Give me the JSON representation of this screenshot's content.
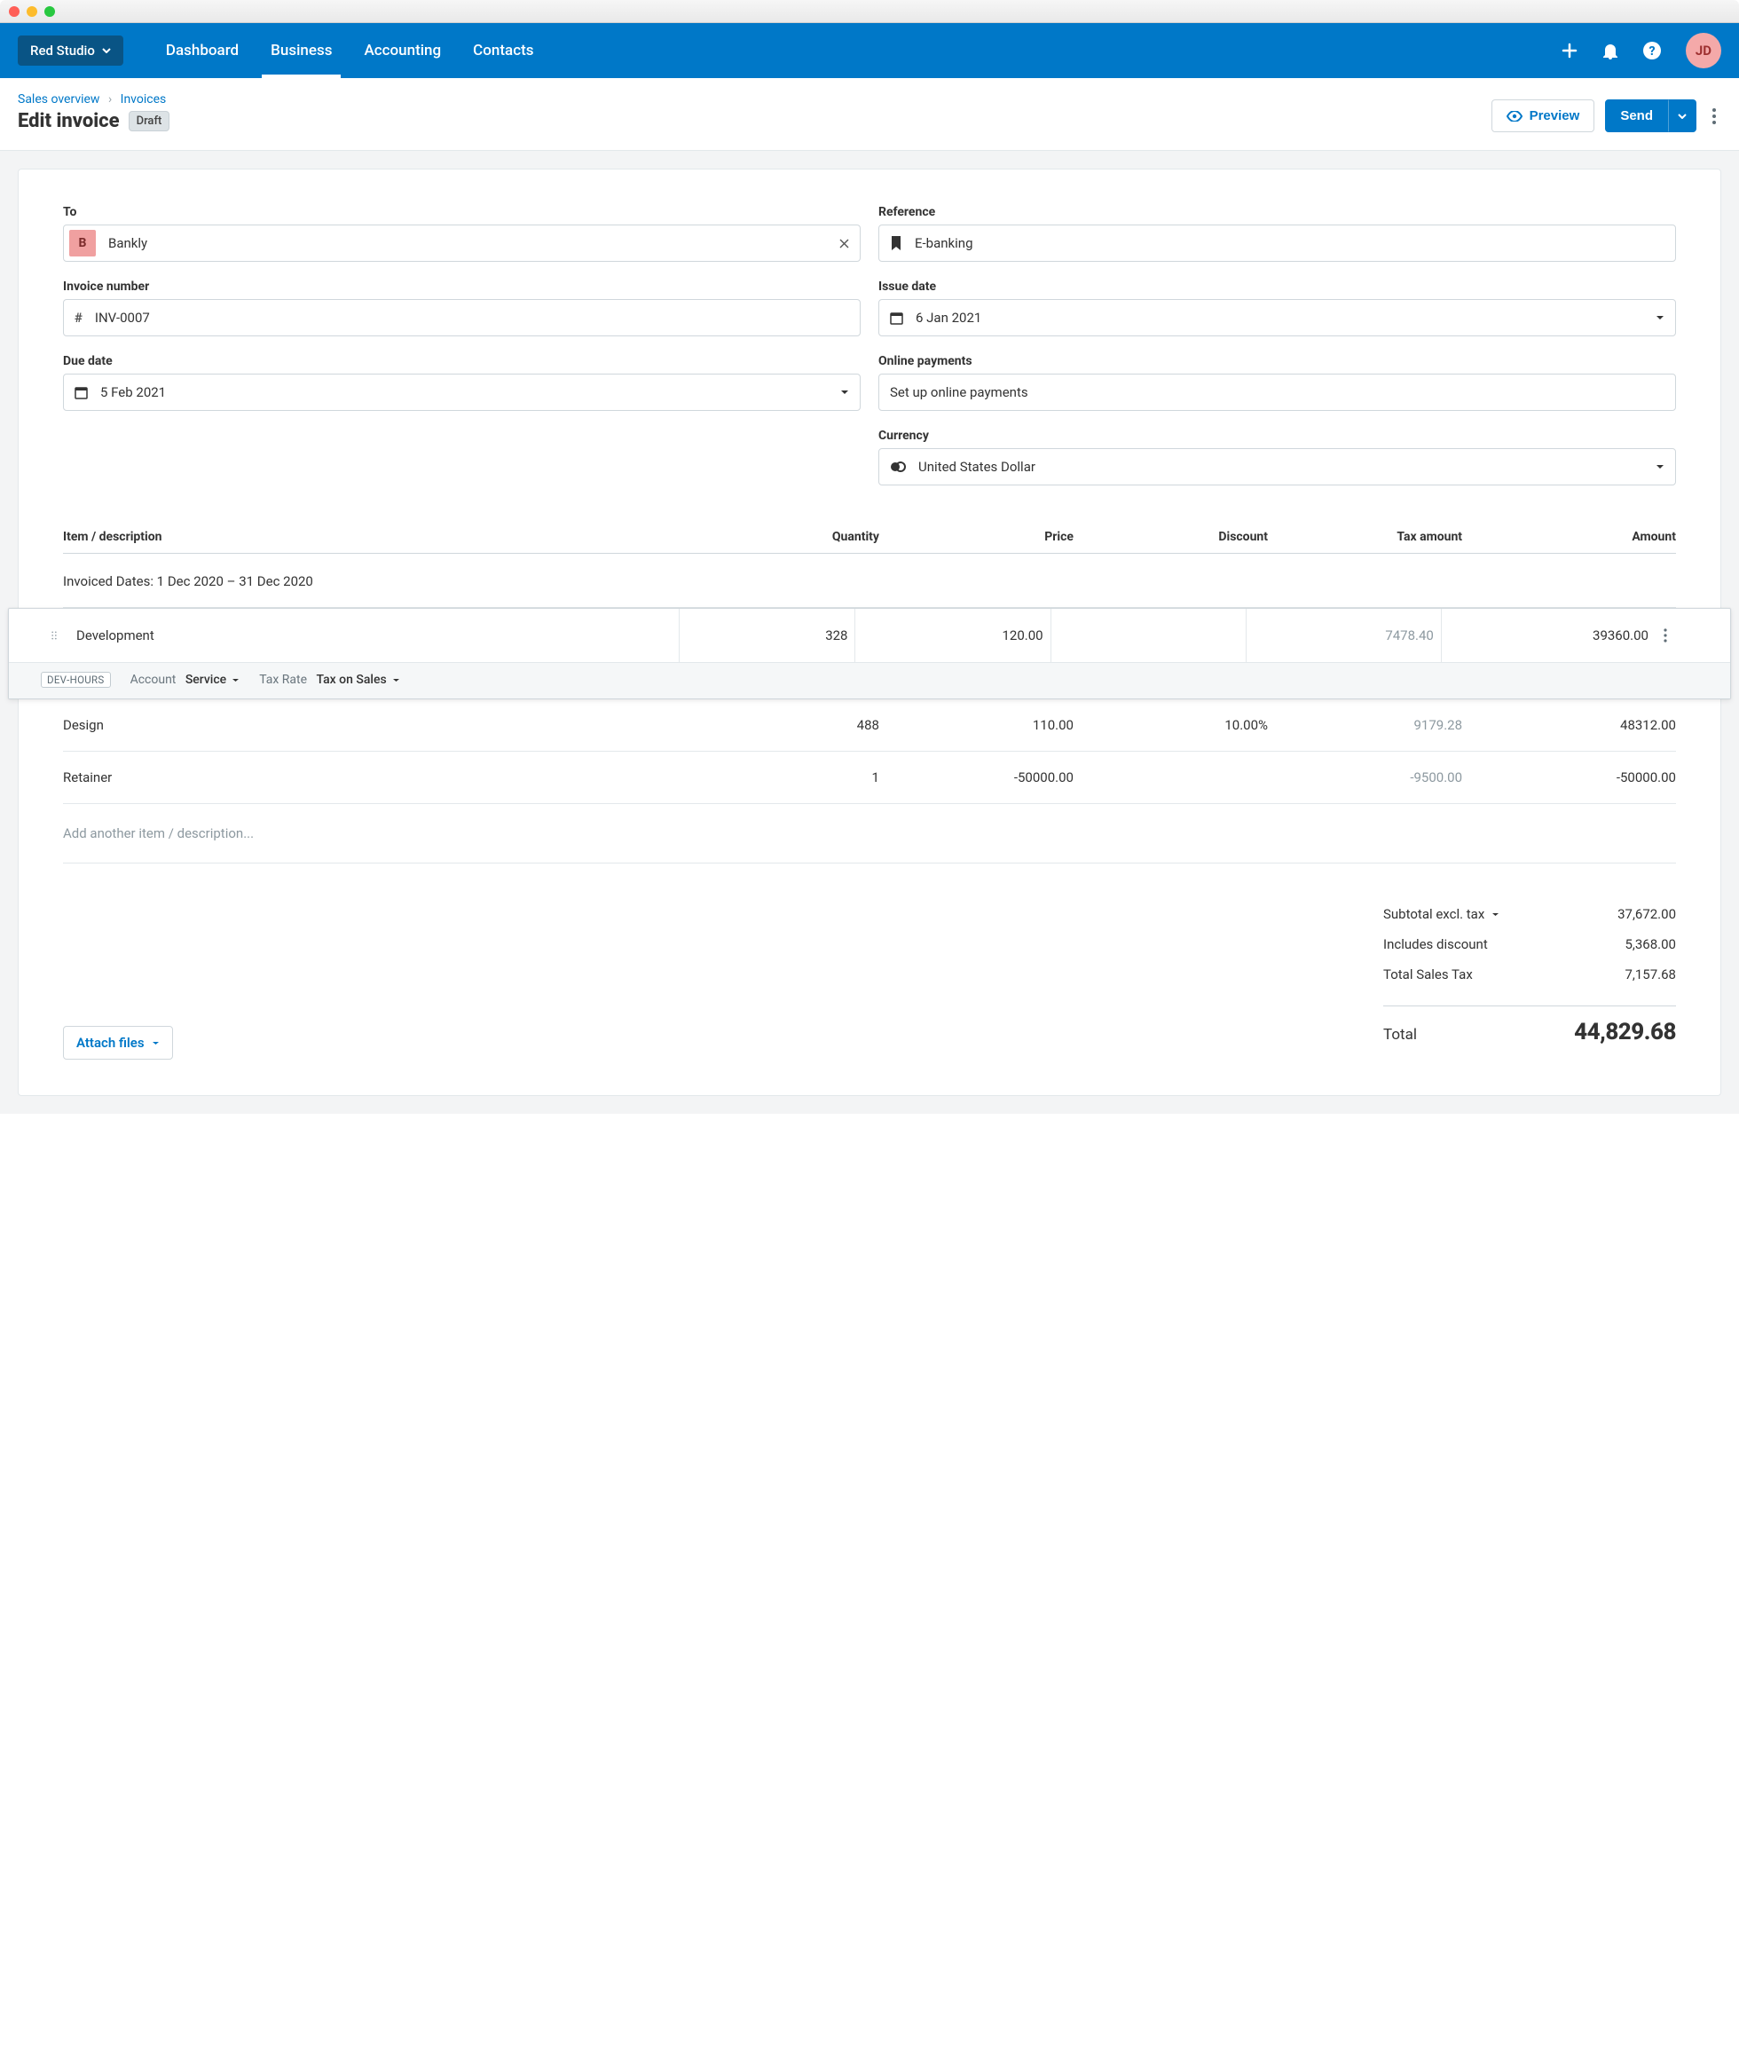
{
  "org": {
    "name": "Red Studio"
  },
  "nav": {
    "items": [
      "Dashboard",
      "Business",
      "Accounting",
      "Contacts"
    ],
    "active_index": 1
  },
  "user": {
    "initials": "JD"
  },
  "breadcrumb": {
    "sales_overview": "Sales overview",
    "invoices": "Invoices"
  },
  "page": {
    "title": "Edit invoice",
    "status": "Draft"
  },
  "actions": {
    "preview": "Preview",
    "send": "Send"
  },
  "form": {
    "to": {
      "label": "To",
      "initial": "B",
      "value": "Bankly"
    },
    "reference": {
      "label": "Reference",
      "value": "E-banking"
    },
    "invoice_number": {
      "label": "Invoice number",
      "value": "INV-0007"
    },
    "issue_date": {
      "label": "Issue date",
      "value": "6 Jan 2021"
    },
    "due_date": {
      "label": "Due date",
      "value": "5 Feb 2021"
    },
    "online_payments": {
      "label": "Online payments",
      "cta": "Set up online payments"
    },
    "currency": {
      "label": "Currency",
      "value": "United States Dollar"
    }
  },
  "table": {
    "headers": {
      "item": "Item / description",
      "qty": "Quantity",
      "price": "Price",
      "discount": "Discount",
      "tax": "Tax amount",
      "amount": "Amount"
    },
    "invoiced_dates": "Invoiced Dates: 1 Dec 2020 – 31 Dec 2020",
    "active_row": {
      "description": "Development",
      "qty": "328",
      "price": "120.00",
      "discount": "",
      "tax": "7478.40",
      "amount": "39360.00",
      "tag": "DEV-HOURS",
      "account_label": "Account",
      "account_value": "Service",
      "taxrate_label": "Tax Rate",
      "taxrate_value": "Tax on Sales"
    },
    "rows": [
      {
        "description": "Design",
        "qty": "488",
        "price": "110.00",
        "discount": "10.00%",
        "tax": "9179.28",
        "amount": "48312.00"
      },
      {
        "description": "Retainer",
        "qty": "1",
        "price": "-50000.00",
        "discount": "",
        "tax": "-9500.00",
        "amount": "-50000.00"
      }
    ],
    "add_placeholder": "Add another item / description..."
  },
  "totals": {
    "subtotal_label": "Subtotal excl. tax",
    "subtotal_value": "37,672.00",
    "discount_label": "Includes discount",
    "discount_value": "5,368.00",
    "tax_label": "Total Sales Tax",
    "tax_value": "7,157.68",
    "total_label": "Total",
    "total_value": "44,829.68"
  },
  "footer": {
    "attach": "Attach files"
  }
}
